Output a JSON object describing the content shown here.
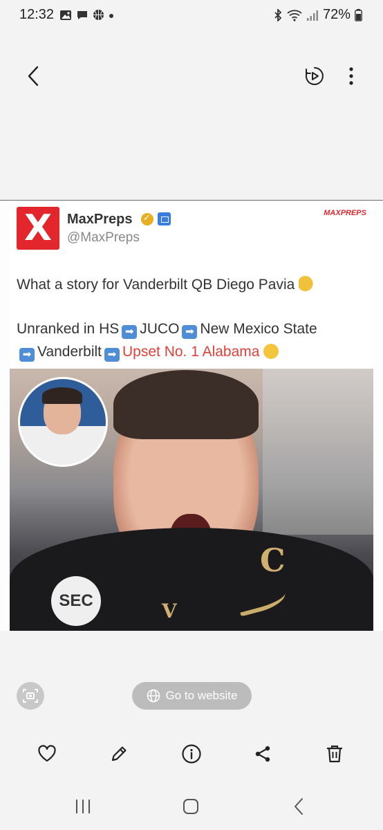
{
  "status_bar": {
    "time": "12:32",
    "battery": "72%",
    "left_icons": [
      "gallery-icon",
      "message-icon",
      "basketball-icon",
      "dot-icon"
    ],
    "right_icons": [
      "bluetooth-icon",
      "wifi-icon",
      "signal-icon",
      "battery-icon"
    ]
  },
  "top_bar": {
    "icons": [
      "back-icon",
      "motion-photo-icon",
      "more-icon"
    ]
  },
  "tweet": {
    "logo_letter": "X",
    "account_name": "MaxPreps",
    "handle": "@MaxPreps",
    "brand_mark": "MAXPREPS",
    "line1": "What a story for Vanderbilt QB Diego Pavia",
    "line2_a": "Unranked in HS",
    "line2_b": "JUCO",
    "line2_c": "New Mexico State",
    "line3_a": "Vanderbilt",
    "line3_b": "Upset No. 1 Alabama",
    "arrow_glyph": "➡"
  },
  "photo": {
    "jersey_letter": "C",
    "patch_text": "SEC",
    "school_letter": "V"
  },
  "actions": {
    "website_label": "Go to website",
    "icons": [
      "heart-icon",
      "edit-icon",
      "info-icon",
      "share-icon",
      "delete-icon"
    ]
  },
  "nav_bar": {
    "icons": [
      "recents-icon",
      "home-icon",
      "back-nav-icon"
    ]
  },
  "colors": {
    "background": "#f3f3f3",
    "brand_red": "#e3262b",
    "accent_blue": "#4f8ed6",
    "pill_gray": "#bcbcbc"
  }
}
